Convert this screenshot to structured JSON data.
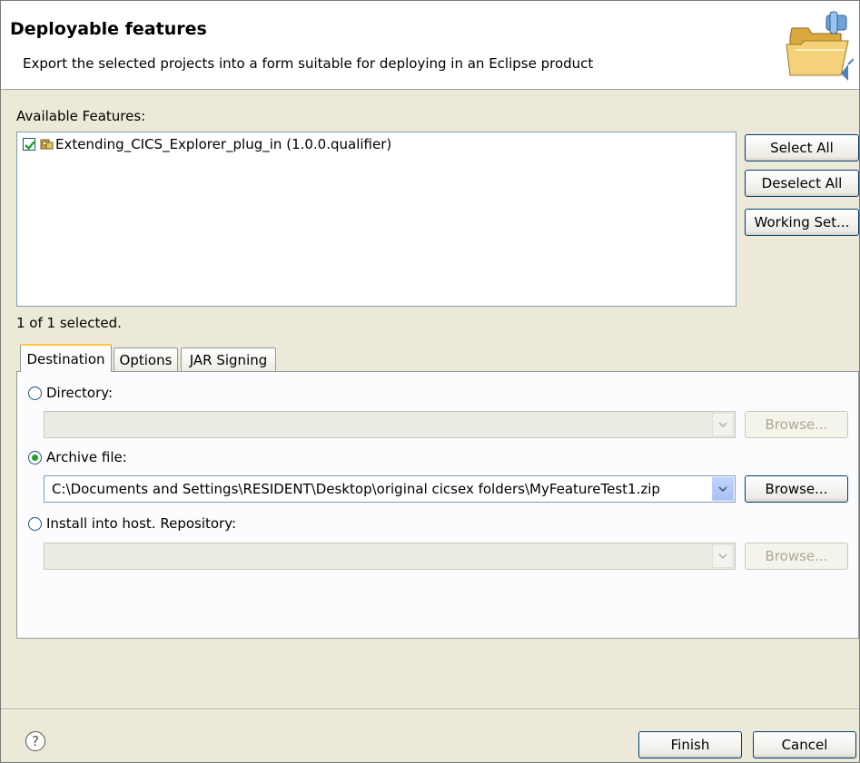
{
  "header": {
    "title": "Deployable features",
    "description": "Export the selected projects into a form suitable for deploying in an Eclipse product",
    "icon": "folder-export-icon"
  },
  "features": {
    "label": "Available Features:",
    "items": [
      {
        "label": "Extending_CICS_Explorer_plug_in (1.0.0.qualifier)",
        "checked": true,
        "icon": "feature-plugin-icon"
      }
    ],
    "status": "1 of 1 selected.",
    "buttons": {
      "select_all": "Select All",
      "deselect_all": "Deselect All",
      "working_set": "Working Set..."
    }
  },
  "tabs": [
    {
      "label": "Destination",
      "active": true
    },
    {
      "label": "Options",
      "active": false
    },
    {
      "label": "JAR Signing",
      "active": false
    }
  ],
  "destination": {
    "directory": {
      "label": "Directory:",
      "selected": false,
      "value": "",
      "browse_label": "Browse...",
      "enabled": false
    },
    "archive": {
      "label": "Archive file:",
      "selected": true,
      "value": "C:\\Documents and Settings\\RESIDENT\\Desktop\\original cicsex folders\\MyFeatureTest1.zip",
      "browse_label": "Browse...",
      "enabled": true
    },
    "install": {
      "label": "Install into host. Repository:",
      "selected": false,
      "value": "",
      "browse_label": "Browse...",
      "enabled": false
    }
  },
  "footer": {
    "help_icon": "help-icon",
    "finish_label": "Finish",
    "cancel_label": "Cancel"
  },
  "colors": {
    "background": "#ece9d8",
    "radio_checked": "#21a121",
    "button_border": "#003c74"
  }
}
